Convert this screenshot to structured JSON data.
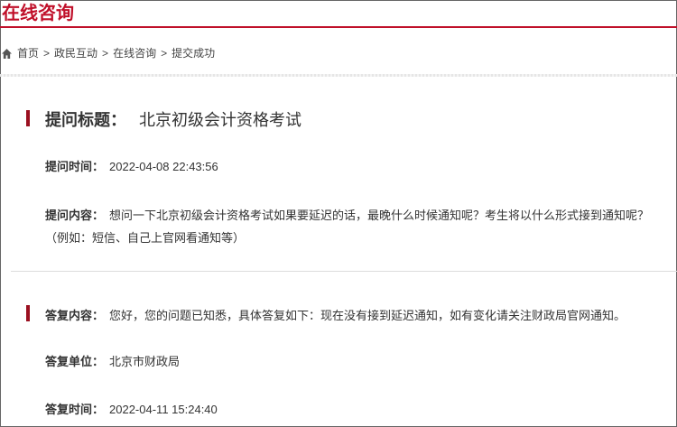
{
  "header": {
    "title": "在线咨询"
  },
  "breadcrumb": {
    "items": [
      "首页",
      "政民互动",
      "在线咨询",
      "提交成功"
    ],
    "separator": ">"
  },
  "question": {
    "title_label": "提问标题：",
    "title": "北京初级会计资格考试",
    "time_label": "提问时间：",
    "time": "2022-04-08 22:43:56",
    "content_label": "提问内容：",
    "content": "想问一下北京初级会计资格考试如果要延迟的话，最晚什么时候通知呢？考生将以什么形式接到通知呢？（例如：短信、自己上官网看通知等）"
  },
  "answer": {
    "content_label": "答复内容：",
    "content": "您好，您的问题已知悉，具体答复如下：现在没有接到延迟通知，如有变化请关注财政局官网通知。",
    "unit_label": "答复单位：",
    "unit": "北京市财政局",
    "time_label": "答复时间：",
    "time": "2022-04-11 15:24:40"
  },
  "colors": {
    "accent": "#c0102a",
    "bar": "#9b1020"
  }
}
